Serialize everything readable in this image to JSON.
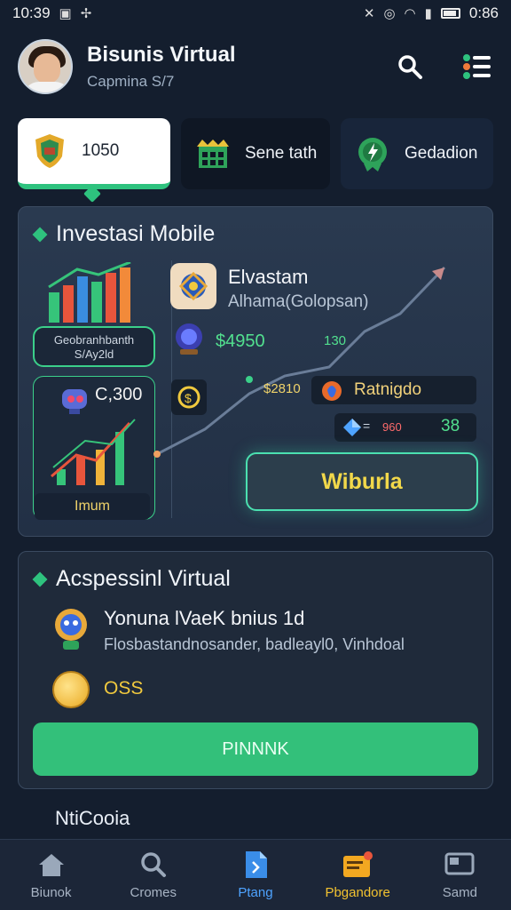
{
  "status_bar": {
    "time": "10:39",
    "battery": "0:86"
  },
  "header": {
    "title": "Bisunis Virtual",
    "subtitle": "Capmina S/7"
  },
  "tiles": [
    {
      "label": "1050"
    },
    {
      "label": "Sene tath"
    },
    {
      "label": "Gedadion"
    }
  ],
  "invest_card": {
    "title": "Investasi Mobile",
    "chart_box_label_1": "Geobranhbanth",
    "chart_box_label_2": "S/Ay2ld",
    "mini_value": "C,300",
    "mini_pill": "Imum",
    "asset_name": "Elvastam",
    "asset_sub": "Alhama(Golopsan)",
    "price_1": "$4950",
    "count_1": "130",
    "price_2": "$2810",
    "pill_a_label": "Ratnigdo",
    "pill_b_red": "960",
    "pill_b_eq": "=",
    "pill_b_green": "38",
    "action_label": "Wiburla"
  },
  "virtual_card": {
    "title": "Acspessinl Virtual",
    "item_title": "Yonuna lVaeK bnius 1d",
    "item_desc": "Flosbastandnosander, badleayl0, Vinhdoal",
    "coins": "OSS",
    "button_label": "PINNNK"
  },
  "section_peek": "NtiCooia",
  "bottom_nav": [
    {
      "label": "Biunok"
    },
    {
      "label": "Cromes"
    },
    {
      "label": "Ptang"
    },
    {
      "label": "Pbgandore"
    },
    {
      "label": "Samd"
    }
  ],
  "colors": {
    "accent_green": "#33c07a",
    "gold": "#f2c230",
    "blue": "#4ea3ff",
    "bg": "#141e2e"
  }
}
